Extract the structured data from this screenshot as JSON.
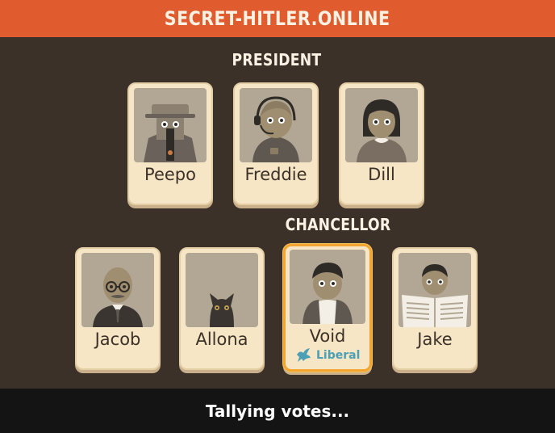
{
  "header": {
    "title": "SECRET-HITLER.ONLINE"
  },
  "labels": {
    "president": "PRESIDENT",
    "chancellor": "CHANCELLOR"
  },
  "president_candidates": [
    {
      "name": "Peepo",
      "icon": "spy-icon"
    },
    {
      "name": "Freddie",
      "icon": "headset-operator-icon"
    },
    {
      "name": "Dill",
      "icon": "woman-collar-icon"
    }
  ],
  "chancellor_candidates": [
    {
      "name": "Jacob",
      "icon": "bald-glasses-man-icon"
    },
    {
      "name": "Allona",
      "icon": "cat-icon"
    },
    {
      "name": "Void",
      "icon": "vest-man-icon",
      "selected": true,
      "role": "Liberal"
    },
    {
      "name": "Jake",
      "icon": "newspaper-reader-icon"
    }
  ],
  "colors": {
    "header": "#e05b2e",
    "background": "#3b3129",
    "card": "#f6e6c5",
    "selected_border": "#f2a531",
    "liberal": "#4c9fb4",
    "footer": "#141414"
  },
  "status": {
    "text": "Tallying votes..."
  }
}
